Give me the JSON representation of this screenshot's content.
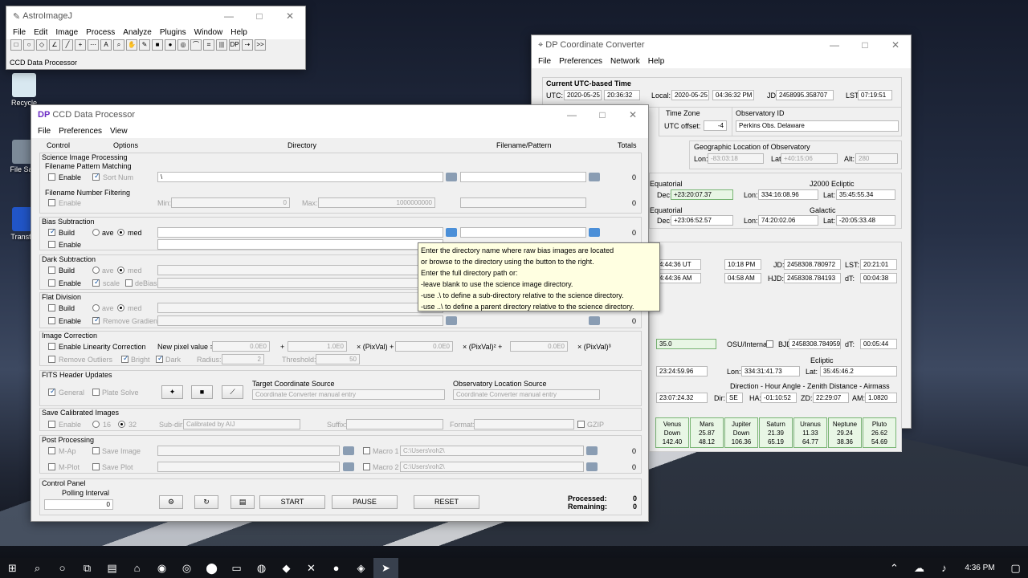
{
  "desktop": {
    "icons": [
      {
        "label": "Recycle"
      },
      {
        "label": "File Sani"
      },
      {
        "label": "Transfor"
      }
    ]
  },
  "astroimage": {
    "title": "AstroImageJ",
    "menu": [
      "File",
      "Edit",
      "Image",
      "Process",
      "Analyze",
      "Plugins",
      "Window",
      "Help"
    ],
    "tools": [
      "□",
      "○",
      "◇",
      "∠",
      "╱",
      "+",
      "⋯",
      "A",
      "⌕",
      "✋",
      "✎",
      "■",
      "●",
      "◎",
      "⌒",
      "⌗",
      "|||",
      "DP",
      "⇢",
      ">>"
    ],
    "status": "CCD Data Processor"
  },
  "converter": {
    "title": "DP Coordinate Converter",
    "menu": [
      "File",
      "Preferences",
      "Network",
      "Help"
    ],
    "utc": {
      "group": "Current UTC-based Time",
      "utc_label": "UTC:",
      "utc_date": "2020-05-25",
      "utc_time": "20:36:32",
      "local_label": "Local:",
      "local_date": "2020-05-25",
      "local_time": "04:36:32 PM",
      "jd_label": "JD:",
      "jd": "2458995.358707",
      "lst_label": "LST:",
      "lst": "07:19:51"
    },
    "timezone": {
      "label": "Time Zone",
      "offset_label": "UTC offset:",
      "offset": "-4"
    },
    "observatory": {
      "label": "Observatory ID",
      "selected": "Perkins Obs. Delaware"
    },
    "geo": {
      "label": "Geographic Location of Observatory",
      "lon_label": "Lon:",
      "lon": "-83:03:18",
      "lat_label": "Lat:",
      "lat": "+40:15:06",
      "alt_label": "Alt:",
      "alt": "280"
    },
    "equatorial1": {
      "label": "Equatorial",
      "dec_label": "Dec:",
      "dec": "+23:20:07.37"
    },
    "ecliptic_j2000": {
      "label": "J2000 Ecliptic",
      "lon_label": "Lon:",
      "lon": "334:16:08.96",
      "lat_label": "Lat:",
      "lat": "35:45:55.34"
    },
    "equatorial2": {
      "label": "Equatorial",
      "dec_label": "Dec:",
      "dec": "+23:06:52.57"
    },
    "galactic": {
      "label": "Galactic",
      "lon_label": "Lon:",
      "lon": "74:20:02.06",
      "lat_label": "Lat:",
      "lat": "-20:05:33.48"
    },
    "times": {
      "ut": "4:44:36 UT",
      "pm": "10:18 PM",
      "jd_label": "JD:",
      "jd": "2458308.780972",
      "lst_label": "LST:",
      "lst": "20:21:01",
      "am": "4:44:36 AM",
      "am2": "04:58 AM",
      "hjd_label": "HJD:",
      "hjd": "2458308.784193",
      "dt_label": "dT:",
      "dt": "00:04:38"
    },
    "osu": {
      "value": "35.0",
      "label": "OSU/Internal",
      "bjd_label": "BJD:",
      "bjd": "2458308.784959",
      "dt_label": "dT:",
      "dt": "00:05:44"
    },
    "ecliptic": {
      "label": "Ecliptic",
      "ra": "23:24:59.96",
      "lon_label": "Lon:",
      "lon": "334:31:41.73",
      "lat_label": "Lat:",
      "lat": "35:45:46.2"
    },
    "direction": {
      "label": "Direction - Hour Angle - Zenith Distance - Airmass",
      "ra": "23:07:24.32",
      "dir_label": "Dir:",
      "dir": "SE",
      "ha_label": "HA:",
      "ha": "-01:10:52",
      "zd_label": "ZD:",
      "zd": "22:29:07",
      "am_label": "AM:",
      "am": "1.0820"
    },
    "planets": [
      {
        "name": "Venus",
        "v1": "Down",
        "v2": "142.40"
      },
      {
        "name": "Mars",
        "v1": "25.87",
        "v2": "48.12"
      },
      {
        "name": "Jupiter",
        "v1": "Down",
        "v2": "106.36"
      },
      {
        "name": "Saturn",
        "v1": "21.39",
        "v2": "65.19"
      },
      {
        "name": "Uranus",
        "v1": "11.33",
        "v2": "64.77"
      },
      {
        "name": "Neptune",
        "v1": "29.24",
        "v2": "38.36"
      },
      {
        "name": "Pluto",
        "v1": "26.62",
        "v2": "54.69"
      }
    ]
  },
  "ccd": {
    "title": "CCD Data Processor",
    "menu": [
      "File",
      "Preferences",
      "View"
    ],
    "headers": {
      "control": "Control",
      "options": "Options",
      "directory": "Directory",
      "pattern": "Filename/Pattern",
      "totals": "Totals"
    },
    "science": {
      "group": "Science Image Processing",
      "pattern_label": "Filename Pattern Matching",
      "enable": "Enable",
      "sort": "Sort Num",
      "dir": "\\",
      "total": "0",
      "number_label": "Filename Number Filtering",
      "min_label": "Min:",
      "min": "0",
      "max_label": "Max:",
      "max": "1000000000",
      "total2": "0"
    },
    "bias": {
      "group": "Bias Subtraction",
      "build": "Build",
      "ave": "ave",
      "med": "med",
      "enable": "Enable",
      "total": "0"
    },
    "dark": {
      "group": "Dark Subtraction",
      "build": "Build",
      "ave": "ave",
      "med": "med",
      "enable": "Enable",
      "scale": "scale",
      "debias": "deBias"
    },
    "flat": {
      "group": "Flat Division",
      "build": "Build",
      "ave": "ave",
      "med": "med",
      "enable": "Enable",
      "remove": "Remove Gradient",
      "total": "0"
    },
    "correction": {
      "group": "Image Correction",
      "enable": "Enable Linearity Correction",
      "pixel_label": "New pixel value =",
      "c0": "0.0E0",
      "plus1": "+",
      "c1": "1.0E0",
      "pix1": "× (PixVal) +",
      "c2": "0.0E0",
      "pix2": "× (PixVal)² +",
      "c3": "0.0E0",
      "pix3": "× (PixVal)³",
      "outliers": "Remove Outliers",
      "bright": "Bright",
      "dark": "Dark",
      "radius_label": "Radius:",
      "radius": "2",
      "threshold_label": "Threshold:",
      "threshold": "50"
    },
    "fits": {
      "group": "FITS Header Updates",
      "general": "General",
      "plate": "Plate Solve",
      "target_label": "Target Coordinate Source",
      "target": "Coordinate Converter manual entry",
      "obs_label": "Observatory Location Source",
      "obs": "Coordinate Converter manual entry"
    },
    "save": {
      "group": "Save Calibrated Images",
      "enable": "Enable",
      "b16": "16",
      "b32": "32",
      "subdir_label": "Sub-dir:",
      "subdir": "Calibrated by AIJ",
      "suffix_label": "Suffix:",
      "format_label": "Format:",
      "gzip": "GZIP"
    },
    "post": {
      "group": "Post Processing",
      "map": "M-Ap",
      "saveimage": "Save Image",
      "macro1_label": "Macro 1",
      "macro1": "C:\\Users\\roh2\\",
      "total1": "0",
      "mplot": "M-Plot",
      "saveplot": "Save Plot",
      "macro2_label": "Macro 2",
      "macro2": "C:\\Users\\roh2\\",
      "total2": "0"
    },
    "control": {
      "group": "Control Panel",
      "polling": "Polling Interval",
      "poll_value": "0",
      "start": "START",
      "pause": "PAUSE",
      "reset": "RESET",
      "processed_label": "Processed:",
      "processed": "0",
      "remaining_label": "Remaining:",
      "remaining": "0"
    },
    "tooltip": [
      "Enter the directory name where raw bias images are located",
      "or browse to the directory using the button to the right.",
      "Enter the full directory path or:",
      "-leave blank to use the science image directory.",
      "-use .\\ to define a sub-directory relative to the science directory.",
      "-use ..\\ to define a parent directory relative to the science directory."
    ]
  },
  "taskbar": {
    "icons": [
      "⊞",
      "⌕",
      "○",
      "⧉",
      "▤",
      "⌂",
      "◉",
      "◎",
      "⬤",
      "▭",
      "◍",
      "◆",
      "✕",
      "●",
      "◈",
      "➤"
    ],
    "time": "4:36 PM"
  }
}
